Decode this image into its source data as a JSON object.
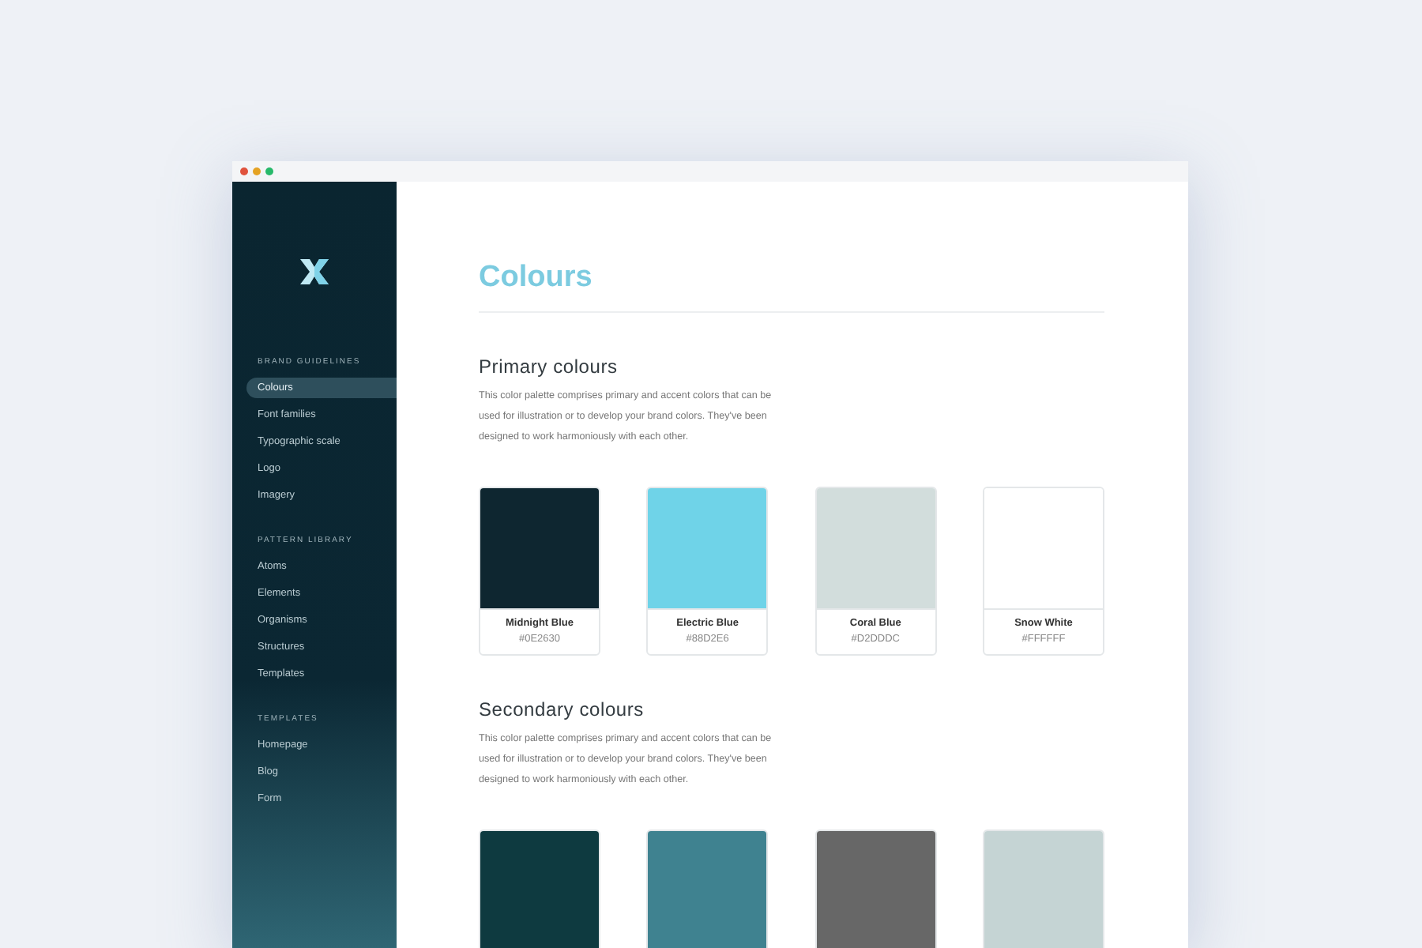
{
  "sidebar": {
    "sections": [
      {
        "heading": "BRAND GUIDELINES",
        "items": [
          {
            "label": "Colours",
            "selected": true
          },
          {
            "label": "Font families",
            "selected": false
          },
          {
            "label": "Typographic scale",
            "selected": false
          },
          {
            "label": "Logo",
            "selected": false
          },
          {
            "label": "Imagery",
            "selected": false
          }
        ]
      },
      {
        "heading": "PATTERN LIBRARY",
        "items": [
          {
            "label": "Atoms",
            "selected": false
          },
          {
            "label": "Elements",
            "selected": false
          },
          {
            "label": "Organisms",
            "selected": false
          },
          {
            "label": "Structures",
            "selected": false
          },
          {
            "label": "Templates",
            "selected": false
          }
        ]
      },
      {
        "heading": "TEMPLATES",
        "items": [
          {
            "label": "Homepage",
            "selected": false
          },
          {
            "label": "Blog",
            "selected": false
          },
          {
            "label": "Form",
            "selected": false
          }
        ]
      }
    ]
  },
  "page": {
    "title": "Colours",
    "sections": [
      {
        "heading": "Primary colours",
        "description": "This color palette comprises primary and accent colors that can be used for illustration or to develop your brand colors. They've been designed to work harmoniously with each other.",
        "swatches": [
          {
            "name": "Midnight Blue",
            "code": "#0E2630",
            "color": "#0e2630"
          },
          {
            "name": "Electric Blue",
            "code": "#88D2E6",
            "color": "#6fd3e8"
          },
          {
            "name": "Coral Blue",
            "code": "#D2DDDC",
            "color": "#d2dddc"
          },
          {
            "name": "Snow White",
            "code": "#FFFFFF",
            "color": "#ffffff"
          }
        ]
      },
      {
        "heading": "Secondary colours",
        "description": "This color palette comprises primary and accent colors that can be used for illustration or to develop your brand colors. They've been designed to work harmoniously with each other.",
        "swatches": [
          {
            "color": "#0e3a40"
          },
          {
            "color": "#3f8290"
          },
          {
            "color": "#676767"
          },
          {
            "color": "#c5d4d4"
          }
        ]
      }
    ]
  }
}
